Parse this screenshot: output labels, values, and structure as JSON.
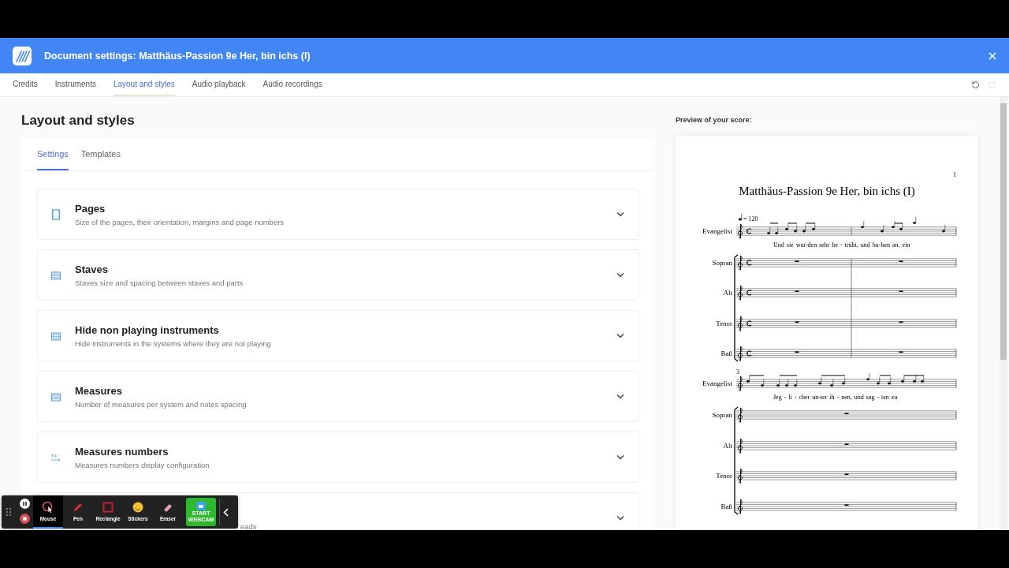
{
  "window": {
    "title": "Document settings: Matthäus-Passion 9e Her, bin ichs (I)"
  },
  "tabs": [
    {
      "label": "Credits",
      "selected": false
    },
    {
      "label": "Instruments",
      "selected": false
    },
    {
      "label": "Layout and styles",
      "selected": true
    },
    {
      "label": "Audio playback",
      "selected": false
    },
    {
      "label": "Audio recordings",
      "selected": false
    }
  ],
  "history": [
    {
      "kind": "undo",
      "disabled": false
    },
    {
      "kind": "redo",
      "disabled": true
    }
  ],
  "page": {
    "heading": "Layout and styles"
  },
  "subtabs": [
    {
      "label": "Settings",
      "selected": true
    },
    {
      "label": "Templates",
      "selected": false
    }
  ],
  "sections": [
    {
      "kind": "pages",
      "title": "Pages",
      "description": "Size of the pages, their orientation, margins and page numbers",
      "expanded": false
    },
    {
      "kind": "staves",
      "title": "Staves",
      "description": "Staves size and spacing between staves and parts",
      "expanded": false
    },
    {
      "kind": "staves",
      "title": "Hide non playing instruments",
      "description": "Hide instruments in the systems where they are not playing",
      "expanded": false
    },
    {
      "kind": "measures",
      "title": "Measures",
      "description": "Number of measures per system and notes spacing",
      "expanded": false
    },
    {
      "kind": "numbers",
      "title": "Measures numbers",
      "description": "Measures numbers display configuration",
      "expanded": false
    },
    {
      "kind": "covered",
      "description": "eads",
      "expanded": false
    }
  ],
  "preview": {
    "label": "Preview of your score:",
    "page_number": "1",
    "score_title": "Matthäus-Passion 9e Her, bin ichs (I)",
    "tempo": "= 120",
    "systems": [
      {
        "staves": [
          {
            "name": "Evangelist",
            "lyrics": "Und sie wur-den sehr be - trübt, und hu-ben an, ein"
          },
          {
            "name": "Sopran"
          },
          {
            "name": "Alt"
          },
          {
            "name": "Tenor"
          },
          {
            "name": "Baß"
          }
        ]
      },
      {
        "measure_number": "3",
        "staves": [
          {
            "name": "Evangelist",
            "lyrics": "Jeg - li - cher un-ter ih - nen, und sag - ten zu"
          },
          {
            "name": "Sopran"
          },
          {
            "name": "Alt"
          },
          {
            "name": "Tenor"
          },
          {
            "name": "Baß"
          }
        ]
      }
    ]
  },
  "recorder": {
    "tools": [
      {
        "kind": "mouse",
        "label": "Mouse",
        "selected": true
      },
      {
        "kind": "pen",
        "label": "Pen",
        "selected": false
      },
      {
        "kind": "rectangle",
        "label": "Rectangle",
        "selected": false
      },
      {
        "kind": "stickers",
        "label": "Stickers",
        "selected": false
      },
      {
        "kind": "eraser",
        "label": "Eraser",
        "selected": false
      }
    ],
    "webcam_button": "START WEBCAM"
  }
}
